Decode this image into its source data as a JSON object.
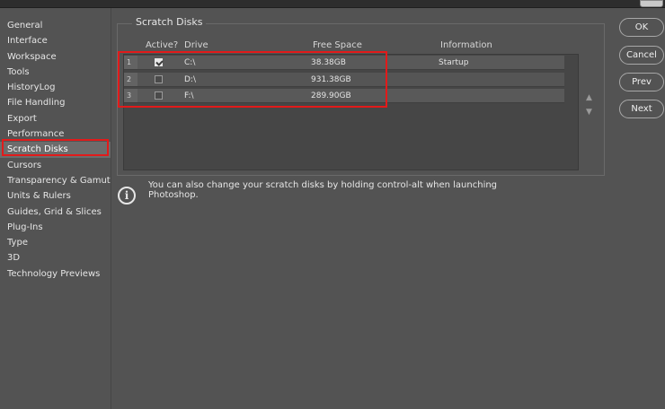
{
  "sidebar": {
    "items": [
      {
        "label": "General"
      },
      {
        "label": "Interface"
      },
      {
        "label": "Workspace"
      },
      {
        "label": "Tools"
      },
      {
        "label": "HistoryLog"
      },
      {
        "label": "File Handling"
      },
      {
        "label": "Export"
      },
      {
        "label": "Performance"
      },
      {
        "label": "Scratch Disks",
        "selected": true
      },
      {
        "label": "Cursors"
      },
      {
        "label": "Transparency & Gamut"
      },
      {
        "label": "Units & Rulers"
      },
      {
        "label": "Guides, Grid & Slices"
      },
      {
        "label": "Plug-Ins"
      },
      {
        "label": "Type"
      },
      {
        "label": "3D"
      },
      {
        "label": "Technology Previews"
      }
    ]
  },
  "scratch": {
    "group_title": "Scratch Disks",
    "columns": {
      "active": "Active?",
      "drive": "Drive",
      "free": "Free Space",
      "info": "Information"
    },
    "rows": [
      {
        "index": "1",
        "active": true,
        "drive": "C:\\",
        "free": "38.38GB",
        "info": "Startup"
      },
      {
        "index": "2",
        "active": false,
        "drive": "D:\\",
        "free": "931.38GB",
        "info": ""
      },
      {
        "index": "3",
        "active": false,
        "drive": "F:\\",
        "free": "289.90GB",
        "info": ""
      }
    ],
    "info_text": "You can also change your scratch disks by holding control-alt when launching Photoshop."
  },
  "buttons": {
    "ok": "OK",
    "cancel": "Cancel",
    "prev": "Prev",
    "next": "Next"
  },
  "icons": {
    "move_up": "triangle-up",
    "move_down": "triangle-down",
    "info": "info-circle"
  },
  "colors": {
    "highlight": "#e21a1a",
    "background": "#535353"
  }
}
